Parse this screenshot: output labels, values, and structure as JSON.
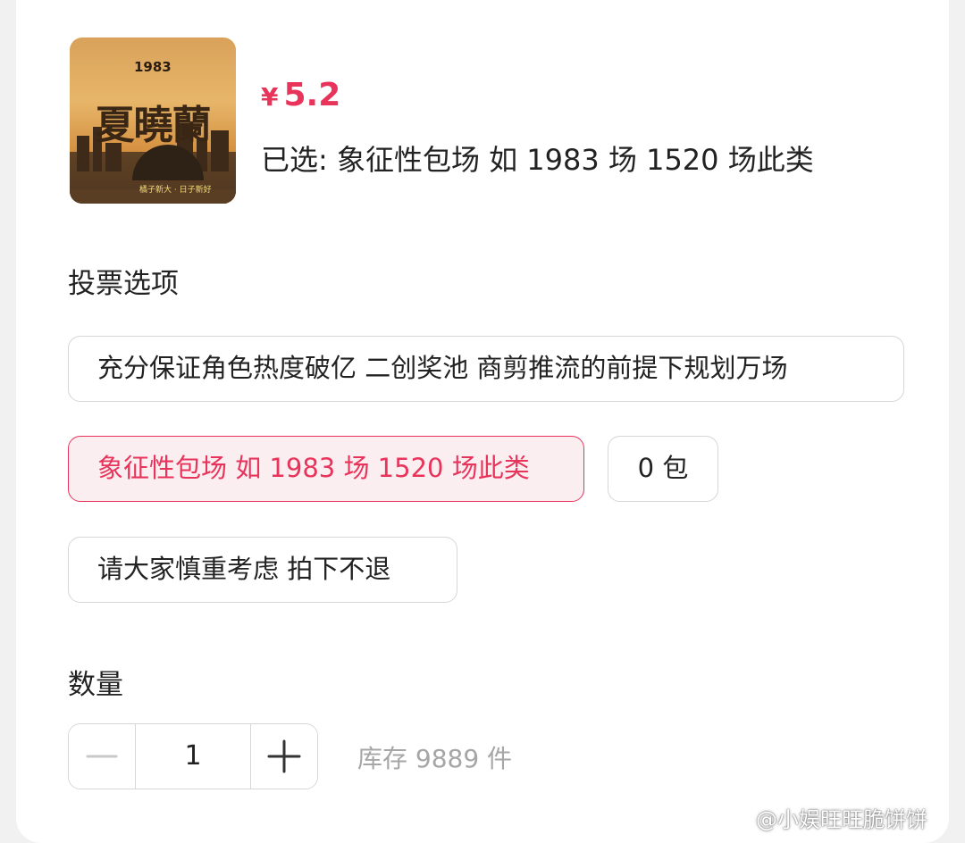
{
  "product": {
    "cover": {
      "badge": "1983",
      "title": "夏曉蘭",
      "slogan": "橘子新大 · 日子新好"
    },
    "price": {
      "currency": "¥",
      "amount": "5.2"
    },
    "selected_text": "已选: 象征性包场 如 1983 场 1520 场此类"
  },
  "vote_section": {
    "title": "投票选项",
    "options": [
      {
        "label": "充分保证角色热度破亿 二创奖池 商剪推流的前提下规划万场",
        "selected": false
      },
      {
        "label": "象征性包场 如 1983 场 1520 场此类",
        "selected": true
      },
      {
        "label": "0 包",
        "selected": false
      },
      {
        "label": "请大家慎重考虑 拍下不退",
        "selected": false
      }
    ]
  },
  "quantity_section": {
    "title": "数量",
    "value": "1",
    "stock": "库存 9889 件"
  },
  "watermark": "@小娱旺旺脆饼饼",
  "colors": {
    "accent": "#e8345b",
    "selected_bg": "#fbeef1",
    "border": "#d6d6d6",
    "muted": "#a6a6a6"
  }
}
